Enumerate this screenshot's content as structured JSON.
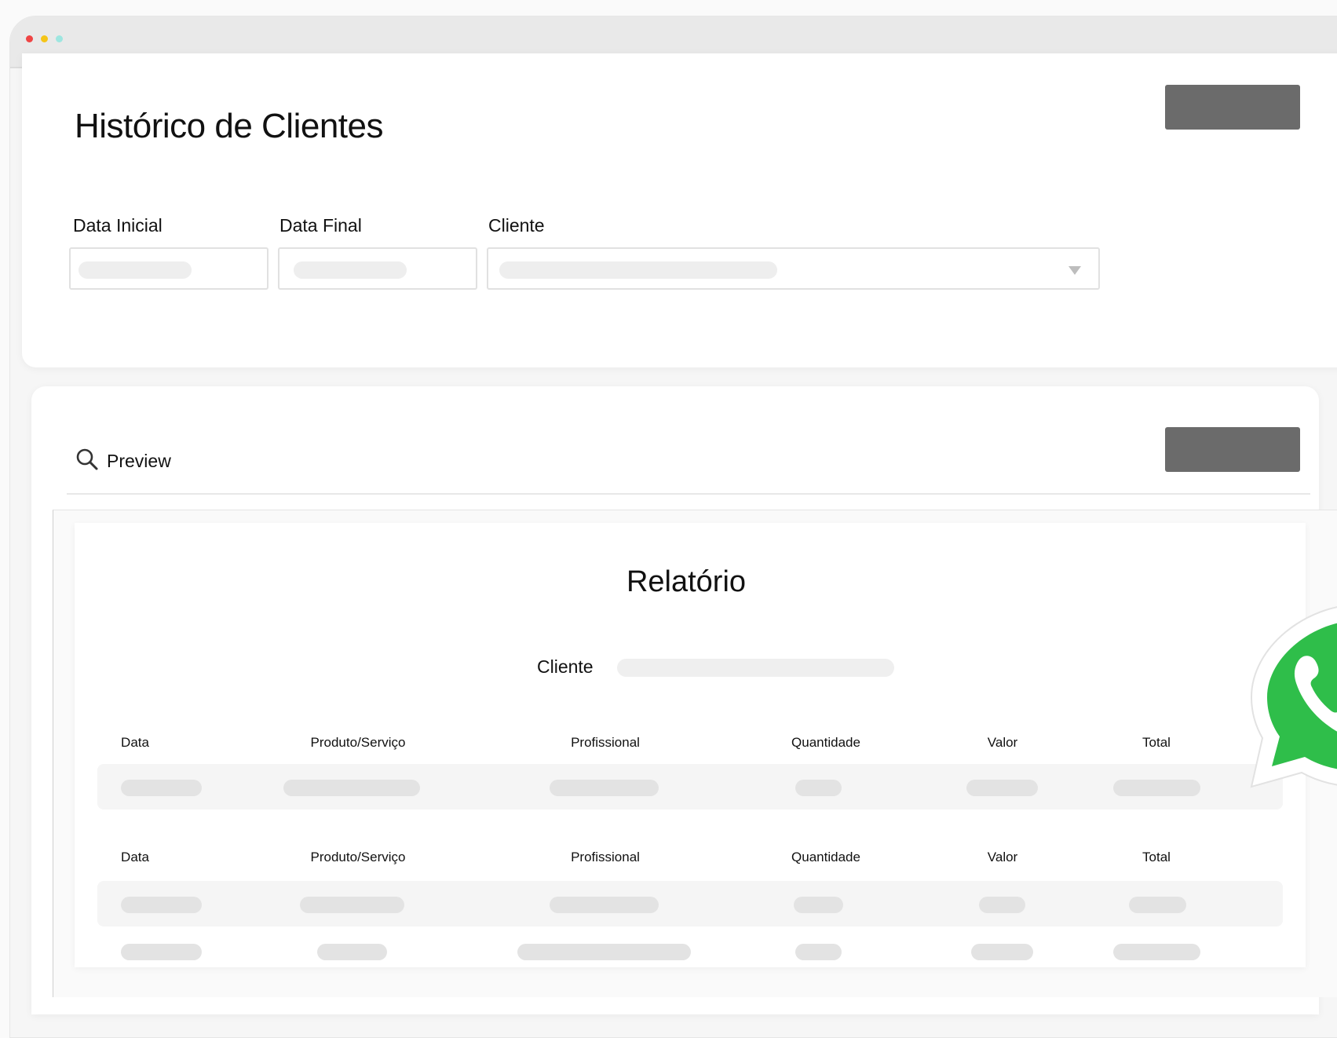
{
  "window": {
    "controls": [
      "close",
      "minimize",
      "maximize"
    ],
    "colors": {
      "close": "#ef4444",
      "minimize": "#f5c518",
      "maximize": "#9ee6e0"
    }
  },
  "header": {
    "title": "Histórico de Clientes"
  },
  "filters": {
    "start_date_label": "Data Inicial",
    "end_date_label": "Data Final",
    "client_label": "Cliente",
    "client_dropdown_icon": "chevron-down-icon"
  },
  "preview": {
    "label": "Preview",
    "icon": "search-icon"
  },
  "report": {
    "title": "Relatório",
    "client_label": "Cliente",
    "columns": [
      "Data",
      "Produto/Serviço",
      "Profissional",
      "Quantidade",
      "Valor",
      "Total"
    ],
    "section_headers": [
      [
        "Data",
        "Produto/Serviço",
        "Profissional",
        "Quantidade",
        "Valor",
        "Total"
      ],
      [
        "Data",
        "Produto/Serviço",
        "Profissional",
        "Quantidade",
        "Valor",
        "Total"
      ]
    ]
  },
  "badge": {
    "icon": "whatsapp-icon",
    "color": "#2fbe4a"
  },
  "colors": {
    "action_button": "#6b6b6b",
    "placeholder": "#eeeeee",
    "row_background": "#f5f5f5"
  }
}
